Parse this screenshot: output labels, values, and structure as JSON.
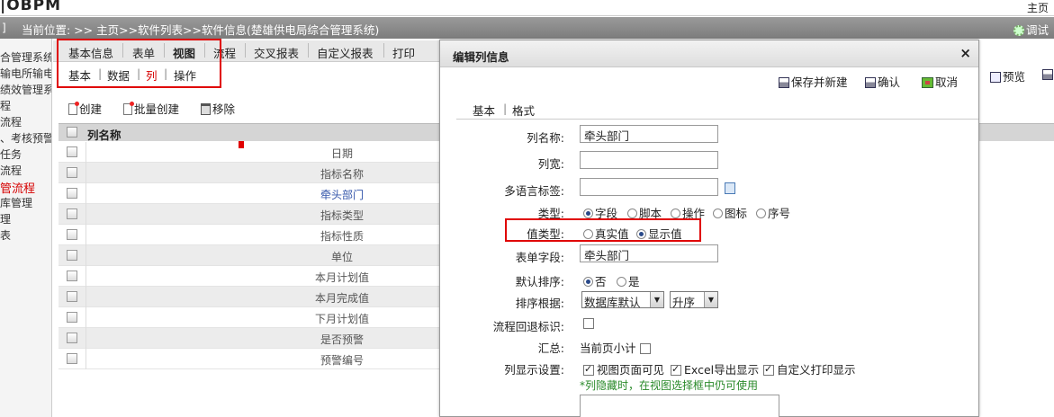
{
  "app": {
    "logo": "|OBPM",
    "top_right": "主页"
  },
  "crumbbar": {
    "left_fragment": "]",
    "breadcrumb": "当前位置: >> 主页>>软件列表>>软件信息(楚雄供电局综合管理系统)",
    "debug": "调试"
  },
  "sidebar": {
    "items": [
      {
        "label": "合管理系统",
        "active": false
      },
      {
        "label": "输电所输电",
        "active": false
      },
      {
        "label": "绩效管理系",
        "active": false
      },
      {
        "label": "程",
        "active": false
      },
      {
        "label": "流程",
        "active": false
      },
      {
        "label": "、考核预警",
        "active": false
      },
      {
        "label": "任务",
        "active": false
      },
      {
        "label": "流程",
        "active": false
      },
      {
        "label": "管流程",
        "active": true
      },
      {
        "label": "库管理",
        "active": false
      },
      {
        "label": "理",
        "active": false
      },
      {
        "label": "表",
        "active": false
      }
    ]
  },
  "tabs": {
    "main": [
      "基本信息",
      "表单",
      "视图",
      "流程",
      "交叉报表",
      "自定义报表",
      "打印"
    ],
    "main_active": "视图",
    "sub": [
      "基本",
      "数据",
      "列",
      "操作"
    ],
    "sub_active": "列"
  },
  "toolbar": {
    "create": "创建",
    "batch_create": "批量创建",
    "remove": "移除"
  },
  "grid": {
    "header": "列名称",
    "rows": [
      "日期",
      "指标名称",
      "牵头部门",
      "指标类型",
      "指标性质",
      "单位",
      "本月计划值",
      "本月完成值",
      "下月计划值",
      "是否预警",
      "预警编号"
    ],
    "highlighted_row": "牵头部门"
  },
  "right_toolbar": {
    "preview": "预览"
  },
  "dialog": {
    "title": "编辑列信息",
    "close": "×",
    "buttons": {
      "save_new": "保存并新建",
      "confirm": "确认",
      "cancel": "取消"
    },
    "tabs": [
      "基本",
      "格式"
    ],
    "fields": {
      "name_label": "列名称:",
      "name_value": "牵头部门",
      "width_label": "列宽:",
      "width_value": "",
      "i18n_label": "多语言标签:",
      "i18n_value": "",
      "type_label": "类型:",
      "type_options": [
        "字段",
        "脚本",
        "操作",
        "图标",
        "序号"
      ],
      "type_selected": "字段",
      "value_type_label": "值类型:",
      "value_type_options": [
        "真实值",
        "显示值"
      ],
      "value_type_selected": "显示值",
      "form_field_label": "表单字段:",
      "form_field_value": "牵头部门",
      "default_sort_label": "默认排序:",
      "default_sort_options": [
        "否",
        "是"
      ],
      "default_sort_selected": "否",
      "sort_by_label": "排序根据:",
      "sort_by_value": "数据库默认",
      "sort_order_value": "升序",
      "flow_back_label": "流程回退标识:",
      "summary_label": "汇总:",
      "summary_option": "当前页小计",
      "display_label": "列显示设置:",
      "display_options": [
        "视图页面可见",
        "Excel导出显示",
        "自定义打印显示"
      ],
      "hidden_note": "*列隐藏时，在视图选择框中仍可使用"
    }
  },
  "colors": {
    "accent_red": "#e00000",
    "link_blue": "#3355aa",
    "note_green": "#2a8a2a"
  }
}
